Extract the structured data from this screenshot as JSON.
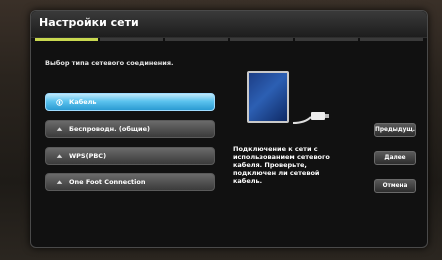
{
  "dialog": {
    "title": "Настройки сети",
    "subtitle": "Выбор типа сетевого соединения.",
    "progress_steps": [
      true,
      false,
      false,
      false,
      false,
      false
    ]
  },
  "options": [
    {
      "label": "Кабель",
      "selected": true,
      "icon": "plug-icon"
    },
    {
      "label": "Беспроводн. (общие)",
      "selected": false,
      "icon": "wireless-icon"
    },
    {
      "label": "WPS(PBC)",
      "selected": false,
      "icon": "wps-icon"
    },
    {
      "label": "One Foot Connection",
      "selected": false,
      "icon": "one-foot-icon"
    }
  ],
  "preview": {
    "description": "Подключение к сети с использованием сетевого кабеля. Проверьте, подключен ли сетевой кабель."
  },
  "buttons": {
    "prev": "Предыдущ.",
    "next": "Далее",
    "cancel": "Отмена"
  }
}
